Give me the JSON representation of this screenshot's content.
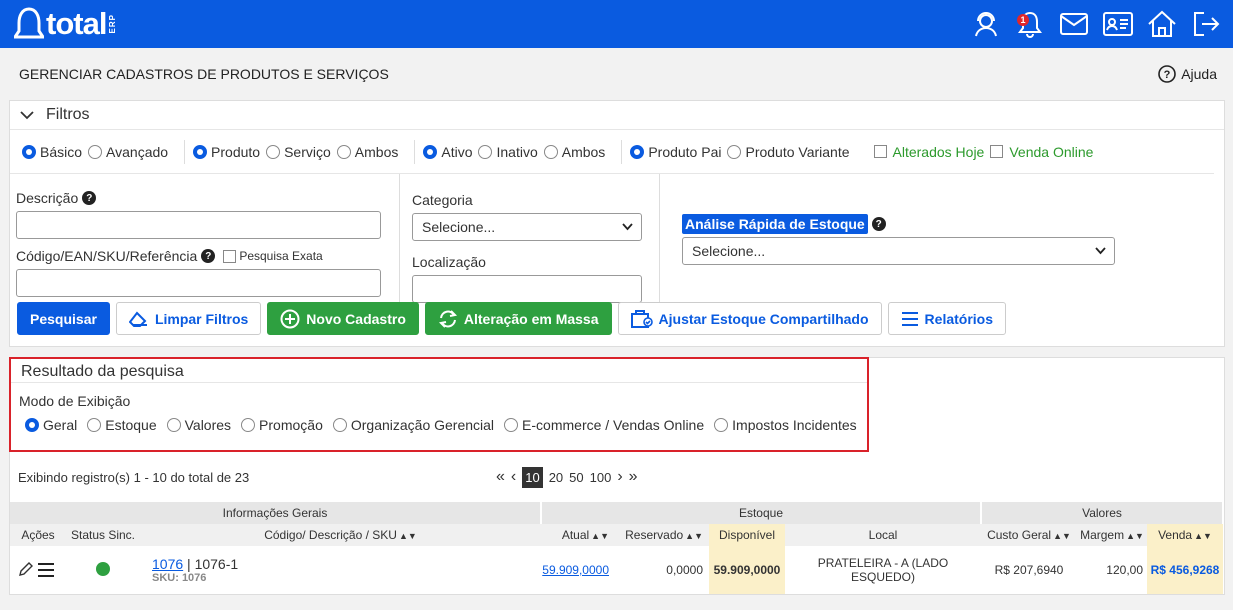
{
  "header": {
    "logo_text": "total",
    "logo_suffix": "ERP",
    "notification_count": "1"
  },
  "page": {
    "title": "GERENCIAR CADASTROS DE PRODUTOS E SERVIÇOS",
    "help_label": "Ajuda"
  },
  "filters": {
    "title": "Filtros",
    "mode_group": [
      "Básico",
      "Avançado"
    ],
    "type_group": [
      "Produto",
      "Serviço",
      "Ambos"
    ],
    "status_group": [
      "Ativo",
      "Inativo",
      "Ambos"
    ],
    "variant_group": [
      "Produto Pai",
      "Produto Variante"
    ],
    "checks": [
      "Alterados Hoje",
      "Venda Online"
    ],
    "descricao_label": "Descrição",
    "codigo_label": "Código/EAN/SKU/Referência",
    "pesquisa_exata_label": "Pesquisa Exata",
    "categoria_label": "Categoria",
    "categoria_value": "Selecione...",
    "localizacao_label": "Localização",
    "analise_label": "Análise Rápida de Estoque",
    "analise_value": "Selecione..."
  },
  "buttons": {
    "pesquisar": "Pesquisar",
    "limpar": "Limpar Filtros",
    "novo": "Novo Cadastro",
    "alteracao": "Alteração em Massa",
    "ajustar": "Ajustar Estoque Compartilhado",
    "relatorios": "Relatórios"
  },
  "results": {
    "title": "Resultado da pesquisa",
    "mode_label": "Modo de Exibição",
    "modes": [
      "Geral",
      "Estoque",
      "Valores",
      "Promoção",
      "Organização Gerencial",
      "E-commerce / Vendas Online",
      "Impostos Incidentes"
    ],
    "summary": "Exibindo registro(s) 1 - 10 do total de 23",
    "page_sizes": [
      "10",
      "20",
      "50",
      "100"
    ]
  },
  "table": {
    "groups": [
      "Informações Gerais",
      "Estoque",
      "Valores"
    ],
    "columns": [
      "Ações",
      "Status Sinc.",
      "Código/ Descrição / SKU",
      "Atual",
      "Reservado",
      "Disponível",
      "Local",
      "Custo Geral",
      "Margem",
      "Venda"
    ],
    "rows": [
      {
        "code": "1076",
        "desc": " | 1076-1",
        "sku": "SKU: 1076",
        "atual": "59.909,0000",
        "reservado": "0,0000",
        "disponivel": "59.909,0000",
        "local": "PRATELEIRA - A (LADO ESQUEDO)",
        "custo": "R$ 207,6940",
        "margem": "120,00",
        "venda": "R$ 456,9268"
      }
    ]
  },
  "colors": {
    "brand": "#0a5be0",
    "green": "#2ea040",
    "highlight": "#fbf0c9",
    "alert": "#d9222a"
  }
}
